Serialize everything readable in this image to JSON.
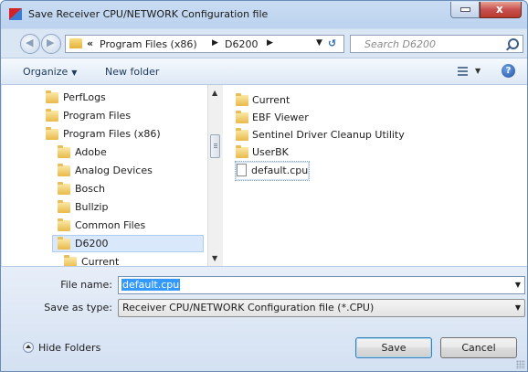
{
  "window": {
    "title": "Save Receiver CPU/NETWORK Configuration file",
    "close_symbol": "x"
  },
  "navigation": {
    "overflow_chevron": "«",
    "breadcrumbs": [
      "Program Files (x86)",
      "D6200"
    ],
    "search_placeholder": "Search D6200"
  },
  "toolbar": {
    "organize_label": "Organize",
    "new_folder_label": "New folder"
  },
  "folder_tree": {
    "items": [
      {
        "label": "PerfLogs",
        "indent": 0
      },
      {
        "label": "Program Files",
        "indent": 0
      },
      {
        "label": "Program Files (x86)",
        "indent": 0
      },
      {
        "label": "Adobe",
        "indent": 1
      },
      {
        "label": "Analog Devices",
        "indent": 1
      },
      {
        "label": "Bosch",
        "indent": 1
      },
      {
        "label": "Bullzip",
        "indent": 1
      },
      {
        "label": "Common Files",
        "indent": 1
      },
      {
        "label": "D6200",
        "indent": 1,
        "selected": true
      },
      {
        "label": "Current",
        "indent": 2
      }
    ]
  },
  "file_list": {
    "items": [
      {
        "label": "Current",
        "type": "folder"
      },
      {
        "label": "EBF Viewer",
        "type": "folder"
      },
      {
        "label": "Sentinel Driver Cleanup Utility",
        "type": "folder"
      },
      {
        "label": "UserBK",
        "type": "folder"
      },
      {
        "label": "default.cpu",
        "type": "file"
      }
    ]
  },
  "form": {
    "file_name_label": "File name:",
    "file_name_value": "default.cpu",
    "save_as_type_label": "Save as type:",
    "save_as_type_value": "Receiver CPU/NETWORK Configuration file (*.CPU)"
  },
  "footer": {
    "hide_folders_label": "Hide Folders",
    "save_label": "Save",
    "cancel_label": "Cancel"
  },
  "colors": {
    "selection": "#3399ff",
    "title_bar": "#c9dcf3",
    "close_button": "#c75050"
  }
}
